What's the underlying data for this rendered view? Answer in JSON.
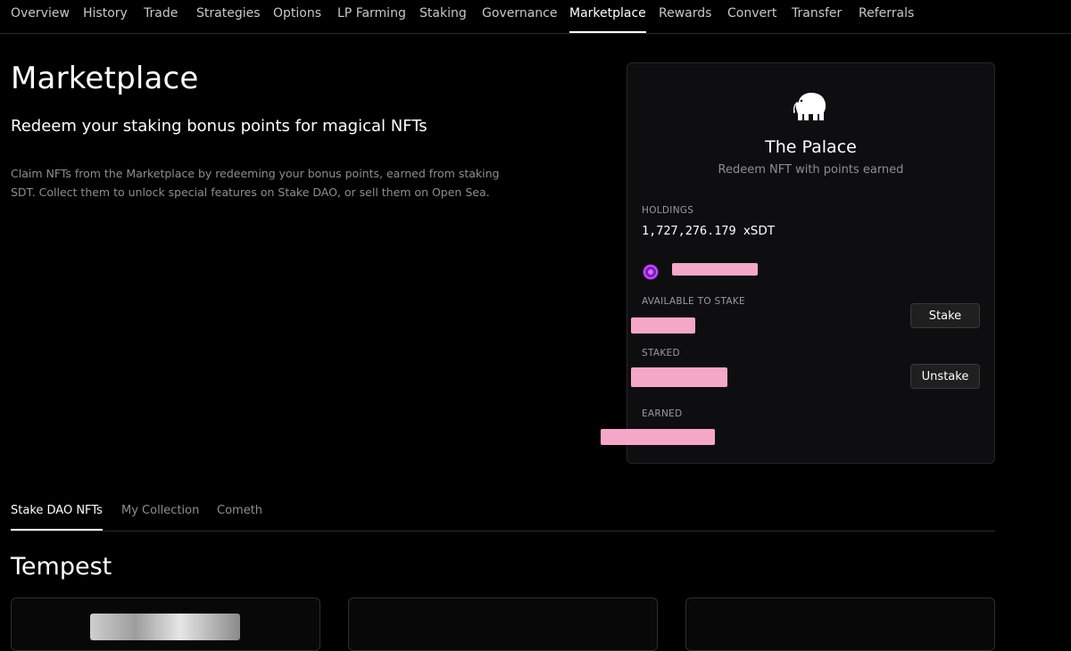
{
  "nav": {
    "items": [
      {
        "label": "Overview"
      },
      {
        "label": "History"
      },
      {
        "label": "Trade"
      },
      {
        "label": "Strategies"
      },
      {
        "label": "Options"
      },
      {
        "label": "LP Farming"
      },
      {
        "label": "Staking"
      },
      {
        "label": "Governance"
      },
      {
        "label": "Marketplace",
        "active": true
      },
      {
        "label": "Rewards"
      },
      {
        "label": "Convert"
      },
      {
        "label": "Transfer"
      },
      {
        "label": "Referrals"
      }
    ]
  },
  "hero": {
    "title": "Marketplace",
    "subtitle": "Redeem your staking bonus points for magical NFTs",
    "description": "Claim NFTs from the Marketplace by redeeming your bonus points, earned from staking SDT. Collect them to unlock special features on Stake DAO, or sell them on Open Sea."
  },
  "palace": {
    "icon": "elephant-icon",
    "title": "The Palace",
    "subtitle": "Redeem NFT with points earned",
    "holdings_label": "HOLDINGS",
    "holdings_value": "1,727,276.179",
    "holdings_unit": "xSDT",
    "available_label": "AVAILABLE TO STAKE",
    "staked_label": "STAKED",
    "earned_label": "EARNED",
    "stake_button": "Stake",
    "unstake_button": "Unstake"
  },
  "tabs": [
    {
      "label": "Stake DAO NFTs",
      "active": true
    },
    {
      "label": "My Collection"
    },
    {
      "label": "Cometh"
    }
  ],
  "collection": {
    "title": "Tempest"
  },
  "colors": {
    "background": "#000000",
    "card": "#0e0e10",
    "muted_text": "#8e8e8e",
    "redaction": "#f5a7c8"
  }
}
